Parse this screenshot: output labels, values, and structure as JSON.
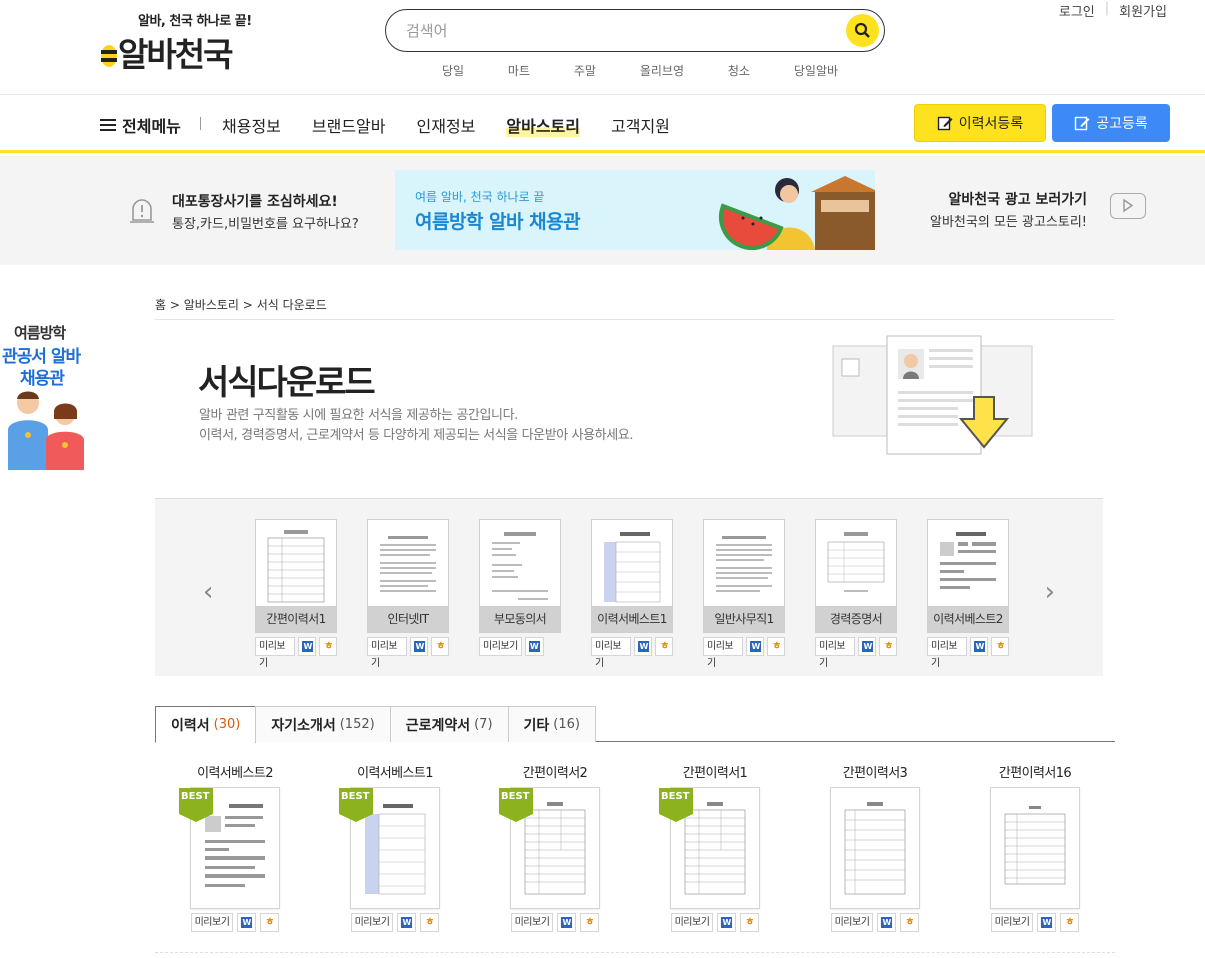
{
  "header": {
    "slogan": "알바, 천국 하나로 끝!",
    "logo_text": "알바천국",
    "search_placeholder": "검색어",
    "keywords": [
      "당일",
      "마트",
      "주말",
      "올리브영",
      "청소",
      "당일알바"
    ],
    "util": {
      "login": "로그인",
      "signup": "회원가입"
    }
  },
  "nav": {
    "all_menu": "전체메뉴",
    "items": [
      "채용정보",
      "브랜드알바",
      "인재정보",
      "알바스토리",
      "고객지원"
    ],
    "active": "알바스토리",
    "resume_button": "이력서등록",
    "post_button": "공고등록"
  },
  "band": {
    "warning_title": "대포통장사기를 조심하세요!",
    "warning_text": "통장,카드,비밀번호를 요구하나요?",
    "banner_small": "여름 알바, 천국 하나로 끝",
    "banner_big": "여름방학 알바 채용관",
    "ad_title": "알바천국 광고 보러가기",
    "ad_text": "알바천국의 모든 광고스토리!"
  },
  "side_banner": {
    "line1": "여름방학",
    "line2": "관공서 알바",
    "line3": "채용관"
  },
  "breadcrumb": {
    "home": "홈",
    "story": "알바스토리",
    "current": "서식 다운로드",
    "sep": ">"
  },
  "page": {
    "title": "서식다운로드",
    "desc1": "알바 관련 구직활동 시에 필요한 서식을 제공하는 공간입니다.",
    "desc2": "이력서, 경력증명서, 근로계약서 등 다양하게 제공되는 서식을 다운받아 사용하세요."
  },
  "preview_label": "미리보기",
  "carousel": [
    {
      "name": "간편이력서1",
      "hwp": true
    },
    {
      "name": "인터넷IT",
      "hwp": true
    },
    {
      "name": "부모동의서",
      "hwp": false
    },
    {
      "name": "이력서베스트1",
      "hwp": true
    },
    {
      "name": "일반사무직1",
      "hwp": true
    },
    {
      "name": "경력증명서",
      "hwp": true
    },
    {
      "name": "이력서베스트2",
      "hwp": true
    }
  ],
  "tabs": [
    {
      "label": "이력서",
      "count": "(30)"
    },
    {
      "label": "자기소개서",
      "count": "(152)"
    },
    {
      "label": "근로계약서",
      "count": "(7)"
    },
    {
      "label": "기타",
      "count": "(16)"
    }
  ],
  "best_label": "BEST",
  "grid": [
    {
      "name": "이력서베스트2",
      "best": true
    },
    {
      "name": "이력서베스트1",
      "best": true
    },
    {
      "name": "간편이력서2",
      "best": true
    },
    {
      "name": "간편이력서1",
      "best": true
    },
    {
      "name": "간편이력서3",
      "best": false
    },
    {
      "name": "간편이력서16",
      "best": false
    }
  ],
  "colors": {
    "brand_yellow": "#ffe21f",
    "post_blue": "#3d8af7",
    "count_orange": "#e05a00",
    "best_green": "#8cb21e"
  }
}
